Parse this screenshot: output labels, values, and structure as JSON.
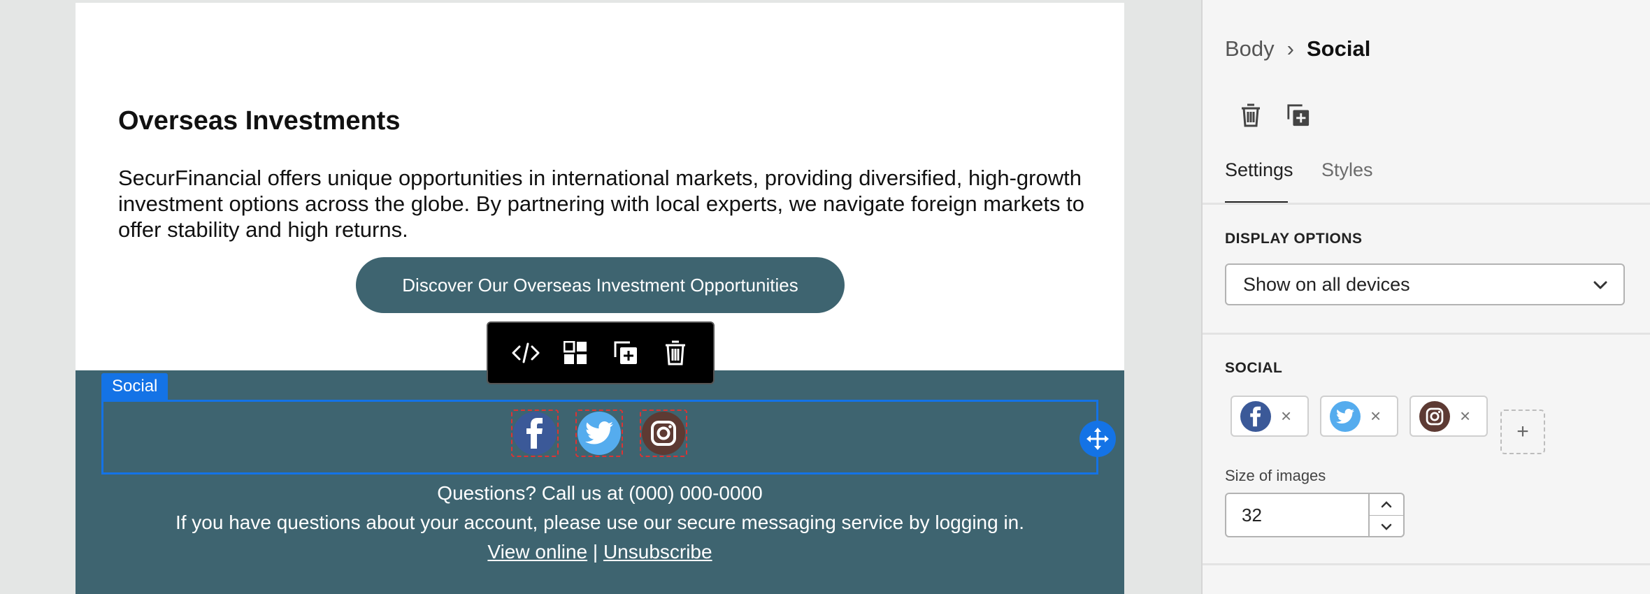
{
  "email": {
    "heading": "Overseas Investments",
    "paragraph": "SecurFinancial offers unique opportunities in international markets, providing diversified, high-growth investment options across the globe. By partnering with local experts, we navigate foreign markets to offer stability and high returns.",
    "cta_label": "Discover Our Overseas Investment Opportunities",
    "social_tag": "Social",
    "social_icons": [
      "facebook-icon",
      "twitter-icon",
      "instagram-icon"
    ],
    "footer": {
      "phone_line": "Questions? Call us at (000) 000-0000",
      "secure_line": "If you have questions about your account, please use our secure messaging service by logging in.",
      "view_online": "View online",
      "separator": " | ",
      "unsubscribe": "Unsubscribe"
    }
  },
  "toolbar": {
    "items": [
      "code-icon",
      "layout-icon",
      "duplicate-icon",
      "trash-icon"
    ]
  },
  "panel": {
    "breadcrumb": {
      "parent": "Body",
      "separator": "›",
      "current": "Social"
    },
    "tabs": [
      {
        "label": "Settings",
        "active": true
      },
      {
        "label": "Styles",
        "active": false
      }
    ],
    "display_options": {
      "title": "DISPLAY OPTIONS",
      "selected": "Show on all devices"
    },
    "social": {
      "title": "SOCIAL",
      "chips": [
        "facebook-icon",
        "twitter-icon",
        "instagram-icon"
      ],
      "remove_glyph": "×",
      "add_glyph": "+"
    },
    "size_of_images": {
      "label": "Size of images",
      "value": "32"
    }
  },
  "colors": {
    "accent": "#1473e6",
    "footer_bg": "#3e6470",
    "facebook": "#3b5998",
    "twitter": "#55acee",
    "instagram": "#5d3a33"
  }
}
